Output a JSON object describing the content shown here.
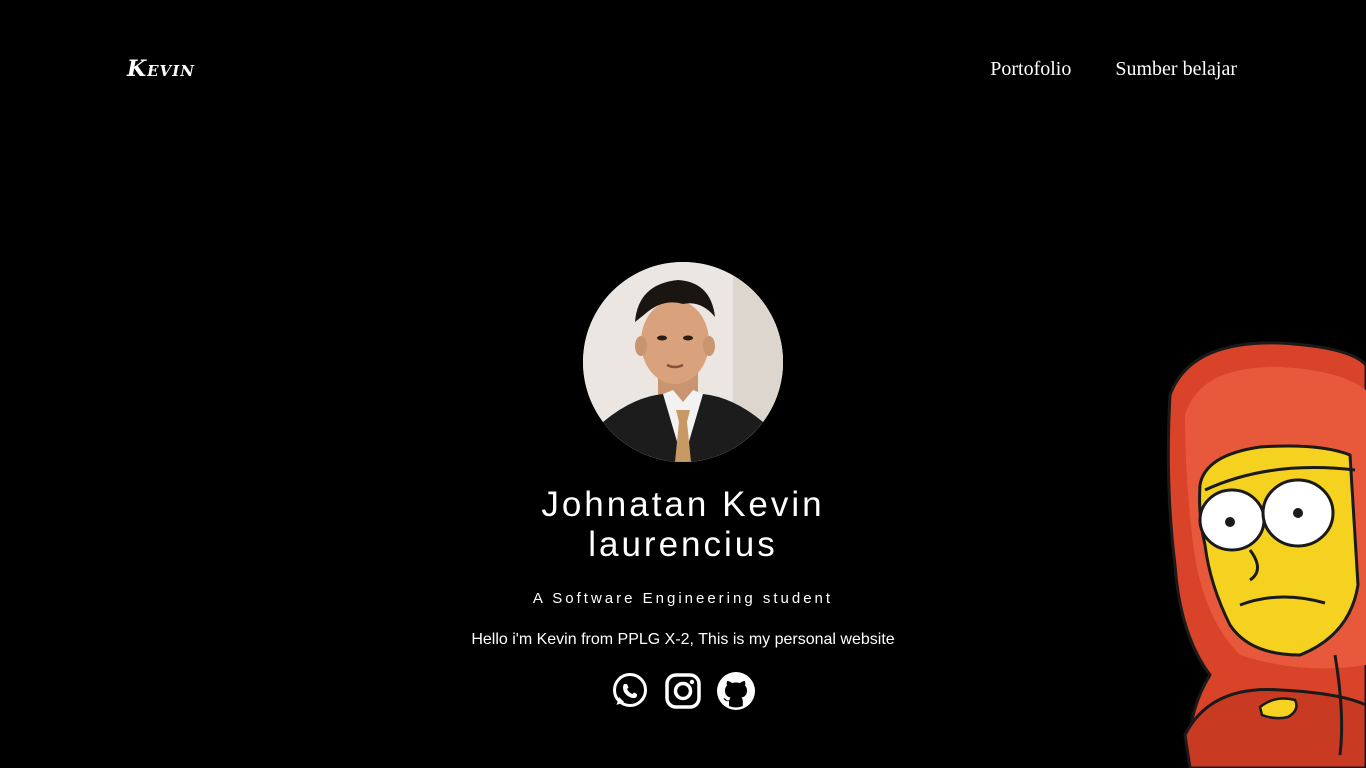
{
  "header": {
    "logo": "Kevin",
    "nav": [
      {
        "label": "Portofolio"
      },
      {
        "label": "Sumber belajar"
      }
    ]
  },
  "hero": {
    "name_line1": "Johnatan Kevin",
    "name_line2": "laurencius",
    "subtitle": "A Software Engineering student",
    "intro": "Hello i'm Kevin from PPLG X-2, This is my personal website"
  },
  "socials": [
    {
      "icon": "whatsapp-icon"
    },
    {
      "icon": "instagram-icon"
    },
    {
      "icon": "github-icon"
    }
  ],
  "colors": {
    "background": "#000000",
    "text": "#ffffff",
    "hoodie": "#d9432a",
    "skin": "#f5d21f"
  }
}
